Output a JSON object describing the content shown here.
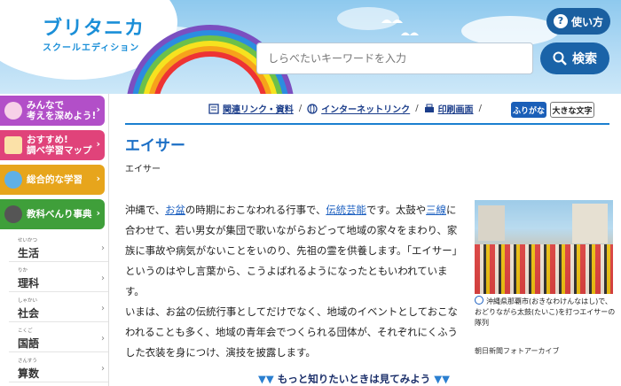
{
  "header": {
    "logo_main": "ブリタニカ",
    "logo_sub": "スクールエディション",
    "help_label": "使い方",
    "search_placeholder": "しらべたいキーワードを入力",
    "search_button": "検索"
  },
  "sidebar": {
    "promos": [
      {
        "label": "みんなで\n考えを深めよう!",
        "color": "#b24fc8"
      },
      {
        "label": "おすすめ!\n調べ学習マップ",
        "color": "#e0437a"
      },
      {
        "label": "総合的な学習",
        "color": "#e7a51c"
      },
      {
        "label": "教科べんり事典",
        "color": "#3f9f3a"
      }
    ],
    "subjects": [
      {
        "label": "生活",
        "ruby": "せいかつ"
      },
      {
        "label": "理科",
        "ruby": "りか"
      },
      {
        "label": "社会",
        "ruby": "しゃかい"
      },
      {
        "label": "国語",
        "ruby": "こくご"
      },
      {
        "label": "算数",
        "ruby": "さんすう"
      }
    ]
  },
  "toolbar": {
    "related": "関連リンク・資料",
    "internet": "インターネットリンク",
    "print": "印刷画面",
    "furigana": "ふりがな",
    "large_text": "大きな文字"
  },
  "article": {
    "title": "エイサー",
    "subtitle": "エイサー",
    "p1_a": "沖縄で、",
    "p1_link1": "お盆",
    "p1_b": "の時期におこなわれる行事で、",
    "p1_link2": "伝統芸能",
    "p1_c": "です。太鼓や",
    "p1_link3": "三線",
    "p1_d": "に合わせて、若い男女が集団で歌いながらおどって地域の家々をまわり、家族に事故や病気がないことをいのり、先祖の霊を供養します。「エイサー」というのはやし言葉から、こうよばれるようになったともいわれています。",
    "p2": "いまは、お盆の伝統行事としてだけでなく、地域のイベントとしておこなわれることも多く、地域の青年会でつくられる団体が、それぞれにくふうした衣装を身につけ、演技を披露します。",
    "caption": "沖縄県那覇市(おきなわけんなはし)で、おどりながら太鼓(たいこ)を打つエイサーの隊列",
    "credit": "朝日新聞フォトアーカイブ",
    "more": "もっと知りたいときは見てみよう"
  }
}
